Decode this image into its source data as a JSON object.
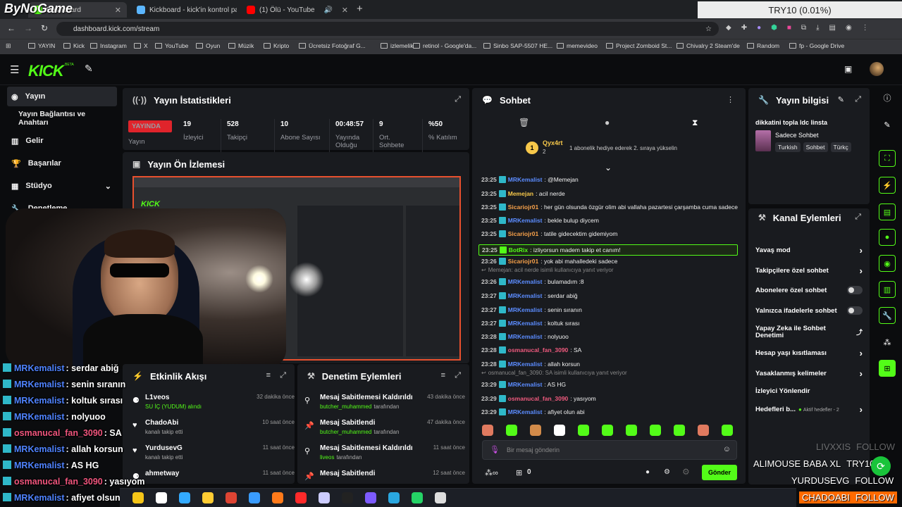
{
  "browser": {
    "tabs": [
      {
        "label": "Dashboard"
      },
      {
        "label": "Kickboard - kick'in kontrol pan"
      },
      {
        "label": "(1) Ölü - YouTube"
      }
    ],
    "url": "dashboard.kick.com/stream",
    "bookmarks": [
      "YAYIN",
      "Kick",
      "Instagram",
      "X",
      "YouTube",
      "Oyun",
      "Müzik",
      "Kripto",
      "Ücretsiz Fotoğraf G...",
      "izlemelik",
      "retinol - Google'da...",
      "Sinbo SAP-5507 HE...",
      "memevideo",
      "Project Zomboid St...",
      "Chivalry 2 Steam'de",
      "Random",
      "fp - Google Drive"
    ]
  },
  "watermark": "ByNoGame",
  "ticker": "TRY10 (0.01%)",
  "brand": {
    "logo": "KICK",
    "beta": "BETA"
  },
  "sidebar": {
    "items": [
      {
        "label": "Yayın"
      },
      {
        "label": "Yayın Bağlantısı ve Anahtarı"
      },
      {
        "label": "Gelir"
      },
      {
        "label": "Başarılar"
      },
      {
        "label": "Stüdyo"
      },
      {
        "label": "Denetleme"
      }
    ]
  },
  "stats": {
    "title": "Yayın İstatistikleri",
    "live_badge": "YAYINDA",
    "live_label": "Yayın",
    "items": [
      {
        "value": "19",
        "label": "İzleyici"
      },
      {
        "value": "528",
        "label": "Takipçi"
      },
      {
        "value": "10",
        "label": "Abone Sayısı"
      },
      {
        "value": "00:48:57",
        "label": "Yayında Olduğu"
      },
      {
        "value": "9",
        "label": "Ort. Sohbete"
      },
      {
        "value": "%50",
        "label": "% Katılım"
      }
    ]
  },
  "preview": {
    "title": "Yayın Ön İzlemesi"
  },
  "feed": {
    "title": "Etkinlik Akışı",
    "items": [
      {
        "name": "L1veos",
        "sub": "SU İÇ (YUDUM) alındı",
        "time": "32 dakika önce"
      },
      {
        "name": "ChadoAbi",
        "sub": "kanalı takip etti",
        "time": "10 saat önce"
      },
      {
        "name": "YurdusevG",
        "sub": "kanalı takip etti",
        "time": "11 saat önce"
      },
      {
        "name": "ahmetway",
        "sub": "",
        "time": "11 saat önce"
      }
    ]
  },
  "modlog": {
    "title": "Denetim Eylemleri",
    "items": [
      {
        "action": "Mesaj Sabitlemesi Kaldırıldı",
        "user": "butcher_muhammed",
        "suffix": "tarafından",
        "time": "43 dakika önce"
      },
      {
        "action": "Mesaj Sabitlendi",
        "user": "butcher_muhammed",
        "suffix": "tarafından",
        "time": "47 dakika önce"
      },
      {
        "action": "Mesaj Sabitlemesi Kaldırıldı",
        "user": "liveos",
        "suffix": "tarafından",
        "time": "11 saat önce"
      },
      {
        "action": "Mesaj Sabitlendi",
        "user": "",
        "suffix": "",
        "time": "12 saat önce"
      }
    ]
  },
  "chat": {
    "title": "Sohbet",
    "pinned_user": "Qyx4rt",
    "pinned_count": "2",
    "pinned_text": "1 abonelik hediye ederek 2. sıraya yükselin",
    "pinned_rank": "1",
    "messages": [
      {
        "time": "23:25",
        "user": "MRKemalist",
        "text": ": @Memejan",
        "color": "#5b8cff"
      },
      {
        "time": "23:25",
        "user": "Memejan",
        "text": ": acil nerde",
        "color": "#f7c84a"
      },
      {
        "time": "23:25",
        "user": "Sicariojr01",
        "text": ": her gün olsunda özgür olim abi vallaha pazartesi çarşamba cuma sadece",
        "color": "#f7a14a"
      },
      {
        "time": "23:25",
        "user": "MRKemalist",
        "text": ": bekle bulup diycem",
        "color": "#5b8cff"
      },
      {
        "time": "23:25",
        "user": "Sicariojr01",
        "text": ": tatile gidecektim gidemiyom",
        "color": "#f7a14a"
      },
      {
        "time": "23:25",
        "user": "BotRix",
        "text": ": izliyorsun madem takip et canım!",
        "color": "#53fc18"
      },
      {
        "time": "23:26",
        "user": "Sicariojr01",
        "text": ": yok abi mahalledeki sadece",
        "color": "#f7a14a"
      },
      {
        "time": "",
        "user": "",
        "text": "Memejan: acil nerde isimli kullanıcıya yanıt veriyor",
        "color": "#888"
      },
      {
        "time": "23:26",
        "user": "MRKemalist",
        "text": ": bulamadım :8",
        "color": "#5b8cff"
      },
      {
        "time": "23:27",
        "user": "MRKemalist",
        "text": ": serdar abiğ",
        "color": "#5b8cff"
      },
      {
        "time": "23:27",
        "user": "MRKemalist",
        "text": ": senin sıranın",
        "color": "#5b8cff"
      },
      {
        "time": "23:27",
        "user": "MRKemalist",
        "text": ": koltuk sırası",
        "color": "#5b8cff"
      },
      {
        "time": "23:28",
        "user": "MRKemalist",
        "text": ": nolyuoo",
        "color": "#5b8cff"
      },
      {
        "time": "23:28",
        "user": "osmanucal_fan_3090",
        "text": ": SA",
        "color": "#f05a7e"
      },
      {
        "time": "23:28",
        "user": "MRKemalist",
        "text": ": allah korsun",
        "color": "#5b8cff"
      },
      {
        "time": "",
        "user": "",
        "text": "osmanucal_fan_3090: SA isimli kullanıcıya yanıt veriyor",
        "color": "#888"
      },
      {
        "time": "23:29",
        "user": "MRKemalist",
        "text": ": AS HG",
        "color": "#5b8cff"
      },
      {
        "time": "23:29",
        "user": "osmanucal_fan_3090",
        "text": ": yasıyom",
        "color": "#f05a7e"
      },
      {
        "time": "23:29",
        "user": "MRKemalist",
        "text": ": afiyet olun abi",
        "color": "#5b8cff"
      }
    ],
    "placeholder": "Bir mesaj gönderin",
    "send": "Gönder",
    "viewers": "0"
  },
  "info": {
    "title": "Yayın bilgisi",
    "stream_title": "dikkatini topla ldc linsta",
    "category": "Sadece Sohbet",
    "tags": [
      "Turkish",
      "Sohbet",
      "Türkç"
    ]
  },
  "channel": {
    "title": "Kanal Eylemleri",
    "items": [
      {
        "label": "Yavaş mod",
        "kind": "chevron"
      },
      {
        "label": "Takipçilere özel sohbet",
        "kind": "chevron"
      },
      {
        "label": "Abonelere özel sohbet",
        "kind": "toggle"
      },
      {
        "label": "Yalnızca ifadelerle sohbet",
        "kind": "toggle"
      },
      {
        "label": "Yapay Zeka ile Sohbet Denetimi",
        "kind": "link"
      },
      {
        "label": "Hesap yaşı kısıtlaması",
        "kind": "chevron"
      },
      {
        "label": "Yasaklanmış kelimeler",
        "kind": "chevron"
      },
      {
        "label": "İzleyici Yönlendir",
        "kind": "none"
      },
      {
        "label": "Hedefleri b...",
        "kind": "chevron",
        "extra": "Aktif hedefler - 2"
      }
    ]
  },
  "overlay_chat": [
    {
      "user": "MRKemalist",
      "text": ": serdar abiğ",
      "color": "#4f83ff"
    },
    {
      "user": "MRKemalist",
      "text": ": senin sıranın",
      "color": "#4f83ff"
    },
    {
      "user": "MRKemalist",
      "text": ": koltuk sırası",
      "color": "#4f83ff"
    },
    {
      "user": "MRKemalist",
      "text": ": nolyuoo",
      "color": "#4f83ff"
    },
    {
      "user": "osmanucal_fan_3090",
      "text": ": SA",
      "color": "#f0557d"
    },
    {
      "user": "MRKemalist",
      "text": ": allah korsun",
      "color": "#4f83ff"
    },
    {
      "user": "MRKemalist",
      "text": ": AS HG",
      "color": "#4f83ff"
    },
    {
      "user": "osmanucal_fan_3090",
      "text": ": yasıyom",
      "color": "#f0557d"
    },
    {
      "user": "MRKemalist",
      "text": ": afiyet olsun abi",
      "color": "#4f83ff"
    }
  ],
  "follow_overlay": [
    {
      "name": "LIVXXIS",
      "label": "FOLLOW"
    },
    {
      "name": "ALIMOUSE BABA XL",
      "label": "TRY10"
    },
    {
      "name": "YURDUSEVG",
      "label": "FOLLOW"
    },
    {
      "name": "CHADOABI",
      "label": "FOLLOW"
    }
  ]
}
